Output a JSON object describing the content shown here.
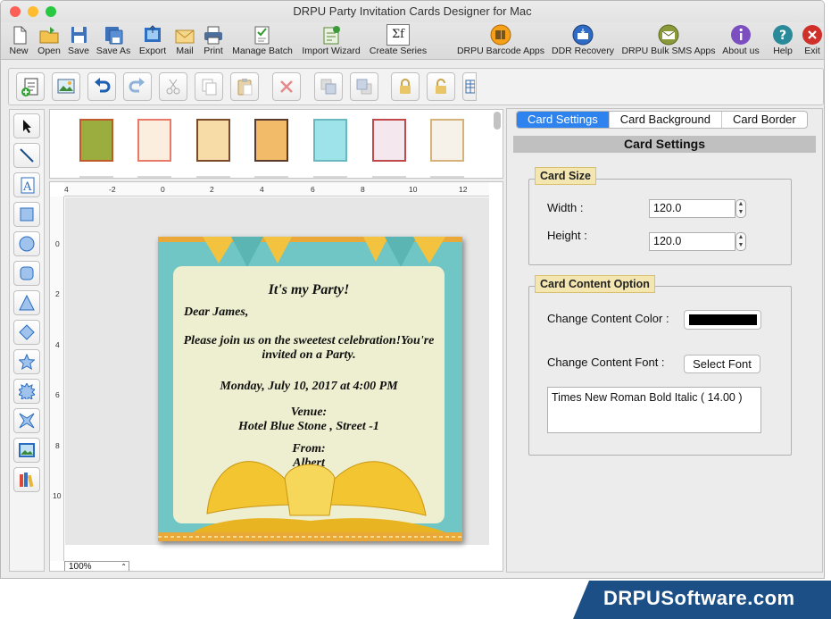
{
  "window": {
    "title": "DRPU Party Invitation Cards Designer for Mac",
    "traffic_colors": [
      "#fd5f57",
      "#febc2e",
      "#28c840"
    ]
  },
  "main_toolbar": {
    "new": "New",
    "open": "Open",
    "save": "Save",
    "save_as": "Save As",
    "export": "Export",
    "mail": "Mail",
    "print": "Print",
    "manage_batch": "Manage Batch",
    "import_wizard": "Import Wizard",
    "create_series": "Create Series",
    "barcode_apps": "DRPU Barcode Apps",
    "ddr_recovery": "DDR Recovery",
    "bulk_sms": "DRPU Bulk SMS Apps",
    "about": "About us",
    "help": "Help",
    "exit": "Exit",
    "create_series_glyph": "Σf"
  },
  "ruler": {
    "h_labels": [
      "4",
      "-2",
      "0",
      "2",
      "4",
      "6",
      "8",
      "10",
      "12"
    ],
    "v_labels": [
      "0",
      "2",
      "4",
      "6",
      "8",
      "10"
    ]
  },
  "canvas": {
    "zoom": "100%"
  },
  "card": {
    "colors": {
      "background": "#6fc6c4",
      "panel": "#eeeed0",
      "bow": "#f2c531"
    },
    "title": "It's my Party!",
    "greeting": "Dear James,",
    "message_line1": "Please join us on the sweetest celebration!You're",
    "message_line2": "invited on a Party.",
    "datetime": "Monday, July 10, 2017 at 4:00 PM",
    "venue_label": "Venue:",
    "venue": "Hotel Blue Stone , Street -1",
    "from_label": "From:",
    "from_name": "Albert"
  },
  "right_panel": {
    "tabs": [
      "Card Settings",
      "Card Background",
      "Card Border"
    ],
    "section_title": "Card Settings",
    "card_size": {
      "label": "Card Size",
      "width_label": "Width :",
      "width_value": "120.0",
      "height_label": "Height :",
      "height_value": "120.0"
    },
    "content_option": {
      "label": "Card Content Option",
      "color_label": "Change Content Color :",
      "color_value": "#000000",
      "font_label": "Change Content Font :",
      "select_font": "Select Font",
      "font_display": "Times New Roman Bold Italic ( 14.00 )"
    }
  },
  "brand": {
    "text": "DRPUSoftware.com",
    "color": "#1b4f86"
  }
}
